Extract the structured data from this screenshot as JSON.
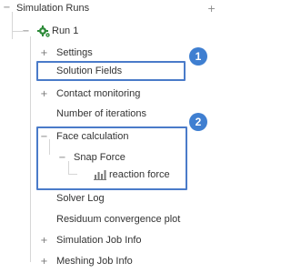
{
  "tree": {
    "root": {
      "label": "Simulation Runs",
      "add_symbol": "+"
    },
    "run": {
      "label": "Run 1",
      "icon": "gear-running-icon",
      "status_color": "#2e8b3a"
    },
    "items": {
      "settings": "Settings",
      "solution_fields": "Solution Fields",
      "contact_monitoring": "Contact monitoring",
      "number_of_iterations": "Number of iterations",
      "face_calculation": "Face calculation",
      "snap_force": "Snap Force",
      "reaction_force": "reaction force",
      "solver_log": "Solver Log",
      "residuum_convergence_plot": "Residuum convergence plot",
      "simulation_job_info": "Simulation Job Info",
      "meshing_job_info": "Meshing Job Info"
    }
  },
  "callouts": {
    "one": "1",
    "two": "2",
    "color": "#3f7fd1"
  }
}
